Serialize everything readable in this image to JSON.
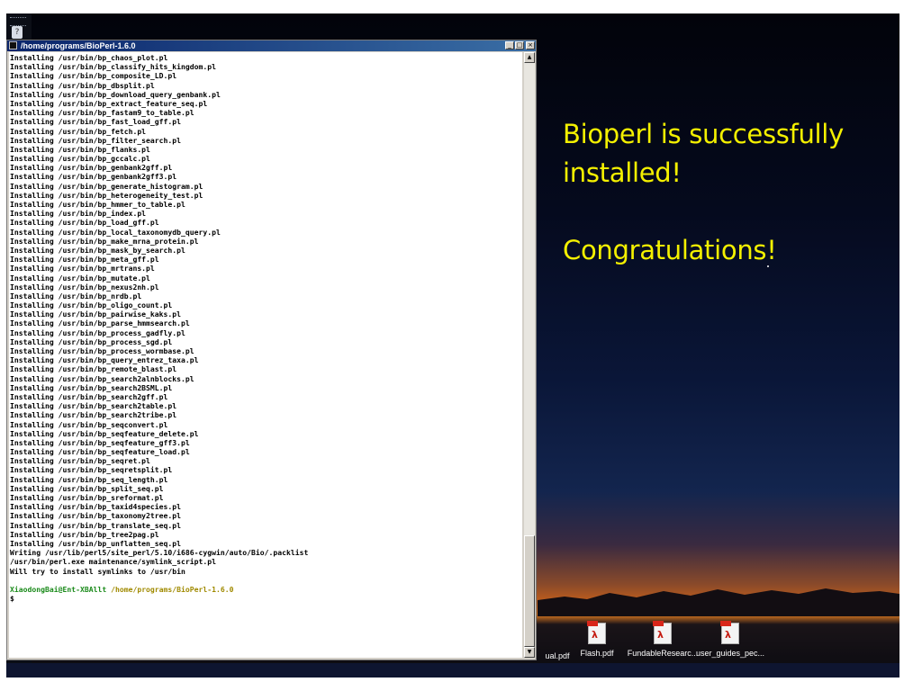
{
  "desktop": {
    "announcement": {
      "line1": "Bioperl is successfully",
      "line2": "installed!",
      "line3": "Congratulations!"
    },
    "files": [
      {
        "label": "ual.pdf",
        "icon": "none"
      },
      {
        "label": "Flash.pdf",
        "icon": "pdf-icon"
      },
      {
        "label": "FundableResearc...",
        "icon": "pdf-icon"
      },
      {
        "label": "user_guides_pec...",
        "icon": "pdf-icon"
      }
    ],
    "quick_launch_icon": "?"
  },
  "terminal": {
    "title": "/home/programs/BioPerl-1.6.0",
    "buttons": {
      "minimize": "_",
      "maximize": "□",
      "close": "×"
    },
    "lines": [
      "Installing /usr/bin/bp_chaos_plot.pl",
      "Installing /usr/bin/bp_classify_hits_kingdom.pl",
      "Installing /usr/bin/bp_composite_LD.pl",
      "Installing /usr/bin/bp_dbsplit.pl",
      "Installing /usr/bin/bp_download_query_genbank.pl",
      "Installing /usr/bin/bp_extract_feature_seq.pl",
      "Installing /usr/bin/bp_fastam9_to_table.pl",
      "Installing /usr/bin/bp_fast_load_gff.pl",
      "Installing /usr/bin/bp_fetch.pl",
      "Installing /usr/bin/bp_filter_search.pl",
      "Installing /usr/bin/bp_flanks.pl",
      "Installing /usr/bin/bp_gccalc.pl",
      "Installing /usr/bin/bp_genbank2gff.pl",
      "Installing /usr/bin/bp_genbank2gff3.pl",
      "Installing /usr/bin/bp_generate_histogram.pl",
      "Installing /usr/bin/bp_heterogeneity_test.pl",
      "Installing /usr/bin/bp_hmmer_to_table.pl",
      "Installing /usr/bin/bp_index.pl",
      "Installing /usr/bin/bp_load_gff.pl",
      "Installing /usr/bin/bp_local_taxonomydb_query.pl",
      "Installing /usr/bin/bp_make_mrna_protein.pl",
      "Installing /usr/bin/bp_mask_by_search.pl",
      "Installing /usr/bin/bp_meta_gff.pl",
      "Installing /usr/bin/bp_mrtrans.pl",
      "Installing /usr/bin/bp_mutate.pl",
      "Installing /usr/bin/bp_nexus2nh.pl",
      "Installing /usr/bin/bp_nrdb.pl",
      "Installing /usr/bin/bp_oligo_count.pl",
      "Installing /usr/bin/bp_pairwise_kaks.pl",
      "Installing /usr/bin/bp_parse_hmmsearch.pl",
      "Installing /usr/bin/bp_process_gadfly.pl",
      "Installing /usr/bin/bp_process_sgd.pl",
      "Installing /usr/bin/bp_process_wormbase.pl",
      "Installing /usr/bin/bp_query_entrez_taxa.pl",
      "Installing /usr/bin/bp_remote_blast.pl",
      "Installing /usr/bin/bp_search2alnblocks.pl",
      "Installing /usr/bin/bp_search2BSML.pl",
      "Installing /usr/bin/bp_search2gff.pl",
      "Installing /usr/bin/bp_search2table.pl",
      "Installing /usr/bin/bp_search2tribe.pl",
      "Installing /usr/bin/bp_seqconvert.pl",
      "Installing /usr/bin/bp_seqfeature_delete.pl",
      "Installing /usr/bin/bp_seqfeature_gff3.pl",
      "Installing /usr/bin/bp_seqfeature_load.pl",
      "Installing /usr/bin/bp_seqret.pl",
      "Installing /usr/bin/bp_seqretsplit.pl",
      "Installing /usr/bin/bp_seq_length.pl",
      "Installing /usr/bin/bp_split_seq.pl",
      "Installing /usr/bin/bp_sreformat.pl",
      "Installing /usr/bin/bp_taxid4species.pl",
      "Installing /usr/bin/bp_taxonomy2tree.pl",
      "Installing /usr/bin/bp_translate_seq.pl",
      "Installing /usr/bin/bp_tree2pag.pl",
      "Installing /usr/bin/bp_unflatten_seq.pl",
      "Writing /usr/lib/perl5/site_perl/5.10/i686-cygwin/auto/Bio/.packlist",
      "/usr/bin/perl.exe maintenance/symlink_script.pl",
      "Will try to install symlinks to /usr/bin"
    ],
    "prompt": {
      "user": "XiaodongBai@Ent-XBAllt",
      "path": "/home/programs/BioPerl-1.6.0",
      "symbol": "$"
    }
  },
  "colors": {
    "announcement_text": "#f4f000",
    "titlebar_start": "#0a246a",
    "titlebar_end": "#3a6ea5",
    "prompt_user": "#1a8a1a",
    "prompt_path": "#a08a00"
  }
}
